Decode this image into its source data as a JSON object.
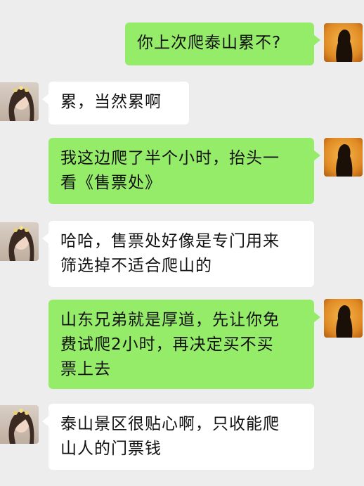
{
  "chat": {
    "messages": [
      {
        "sender": "me",
        "avatar": "avatar-self",
        "text": "你上次爬泰山累不?"
      },
      {
        "sender": "other",
        "avatar": "avatar-friend",
        "text": "累，当然累啊"
      },
      {
        "sender": "me",
        "avatar": "avatar-self",
        "text": "我这边爬了半个小时，抬头一\n看《售票处》"
      },
      {
        "sender": "other",
        "avatar": "avatar-friend",
        "text": "哈哈，售票处好像是专门用来\n筛选掉不适合爬山的"
      },
      {
        "sender": "me",
        "avatar": "avatar-self",
        "text": "山东兄弟就是厚道，先让你免\n费试爬2小时，再决定买不买\n票上去"
      },
      {
        "sender": "other",
        "avatar": "avatar-friend",
        "text": "泰山景区很贴心啊，只收能爬\n山人的门票钱"
      }
    ]
  },
  "colors": {
    "background": "#ededed",
    "my_bubble": "#95ec69",
    "their_bubble": "#ffffff",
    "text": "#111111"
  }
}
